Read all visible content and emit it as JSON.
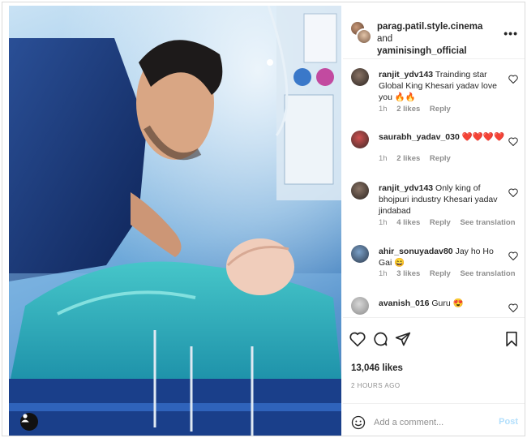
{
  "post": {
    "header": {
      "author1": "parag.patil.style.cinema",
      "joiner": "and",
      "author2": "yaminisingh_official",
      "more_icon": "more-horizontal-icon"
    },
    "comments": [
      {
        "username": "ranjit_ydv143",
        "text": "Trainding star Global King Khesari yadav love you 🔥🔥",
        "time": "1h",
        "likes": "2 likes",
        "reply": "Reply",
        "see_translation": ""
      },
      {
        "username": "saurabh_yadav_030",
        "text": "❤️❤️❤️❤️",
        "time": "1h",
        "likes": "2 likes",
        "reply": "Reply",
        "see_translation": ""
      },
      {
        "username": "ranjit_ydv143",
        "text": "Only king of bhojpuri industry Khesari yadav jindabad",
        "time": "1h",
        "likes": "4 likes",
        "reply": "Reply",
        "see_translation": "See translation"
      },
      {
        "username": "ahir_sonuyadav80",
        "text": "Jay ho Ho Gai 😄",
        "time": "1h",
        "likes": "3 likes",
        "reply": "Reply",
        "see_translation": "See translation"
      },
      {
        "username": "avanish_016",
        "text": "Guru 😍",
        "time": "",
        "likes": "",
        "reply": "",
        "see_translation": ""
      }
    ],
    "likes_count": "13,046 likes",
    "time_ago": "2 HOURS AGO",
    "add_comment": {
      "placeholder": "Add a comment...",
      "post_label": "Post",
      "post_color": "#b2dffc"
    },
    "icons": [
      "heart-icon",
      "comment-icon",
      "share-icon",
      "bookmark-icon",
      "emoji-icon",
      "user-tag-icon"
    ]
  }
}
